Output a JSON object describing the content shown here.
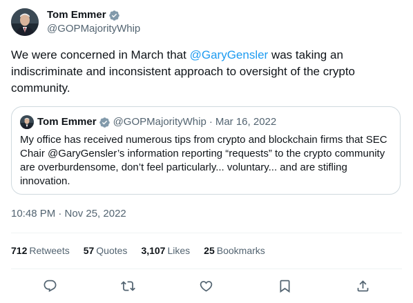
{
  "author": {
    "name": "Tom Emmer",
    "handle": "@GOPMajorityWhip"
  },
  "tweet": {
    "text_before": "We were concerned in March that ",
    "mention": "@GaryGensler",
    "text_after": " was taking an indiscriminate and inconsistent approach to oversight of the crypto community."
  },
  "quote": {
    "name": "Tom Emmer",
    "handle": "@GOPMajorityWhip",
    "separator": "·",
    "date": "Mar 16, 2022",
    "text": "My office has received numerous tips from crypto and blockchain firms that SEC Chair @GaryGensler’s information reporting “requests” to the crypto community are overburdensome, don’t feel particularly... voluntary... and are stifling innovation."
  },
  "timestamp": "10:48 PM · Nov 25, 2022",
  "stats": {
    "retweets_count": "712",
    "retweets_label": "Retweets",
    "quotes_count": "57",
    "quotes_label": "Quotes",
    "likes_count": "3,107",
    "likes_label": "Likes",
    "bookmarks_count": "25",
    "bookmarks_label": "Bookmarks"
  },
  "actions": {
    "icons": [
      "reply-icon",
      "retweet-icon",
      "like-icon",
      "bookmark-icon",
      "share-icon"
    ]
  },
  "colors": {
    "accent": "#1d9bf0",
    "text": "#0f1419",
    "secondary": "#536471",
    "border": "#cfd9de",
    "divider": "#eff3f4"
  }
}
